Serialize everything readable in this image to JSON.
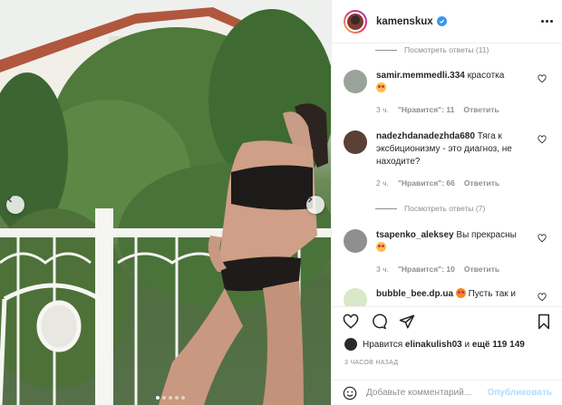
{
  "post": {
    "username": "kamenskux",
    "verified": true,
    "image_description_icon": "photo",
    "carousel": {
      "total": 5,
      "active": 0
    }
  },
  "comments": [
    {
      "type": "replies",
      "label": "Посмотреть ответы (11)"
    },
    {
      "type": "comment",
      "username": "samir.memmedli.334",
      "text": "красотка",
      "emoji": true,
      "time": "3 ч.",
      "likes": "\"Нравится\": 11",
      "reply": "Ответить",
      "avatar_color": "#9aa39a"
    },
    {
      "type": "comment",
      "username": "nadezhdanadezhda680",
      "text": "Тяга к эксбиционизму - это диагноз, не находите?",
      "emoji": false,
      "time": "2 ч.",
      "likes": "\"Нравится\": 66",
      "reply": "Ответить",
      "avatar_color": "#5a4037"
    },
    {
      "type": "replies",
      "label": "Посмотреть ответы (7)"
    },
    {
      "type": "comment",
      "username": "tsapenko_aleksey",
      "text": "Вы прекрасны",
      "emoji": true,
      "time": "3 ч.",
      "likes": "\"Нравится\": 10",
      "reply": "Ответить",
      "avatar_color": "#8f8f8f"
    },
    {
      "type": "comment",
      "username": "bubble_bee.dp.ua",
      "text": "Пусть так и",
      "emoji": false,
      "avatar_color": "#d9e8c7"
    }
  ],
  "likes": {
    "prefix": "Нравится",
    "user": "elinakulish03",
    "middle": "и",
    "rest": "ещё 119 149"
  },
  "timestamp": "3 ЧАСОВ НАЗАД",
  "add_comment": {
    "placeholder": "Добавьте комментарий...",
    "publish": "Опубликовать"
  },
  "colors": {
    "link": "#3897f0",
    "publish_disabled": "#b3dbff",
    "muted": "#8e8e8e",
    "text": "#262626"
  }
}
